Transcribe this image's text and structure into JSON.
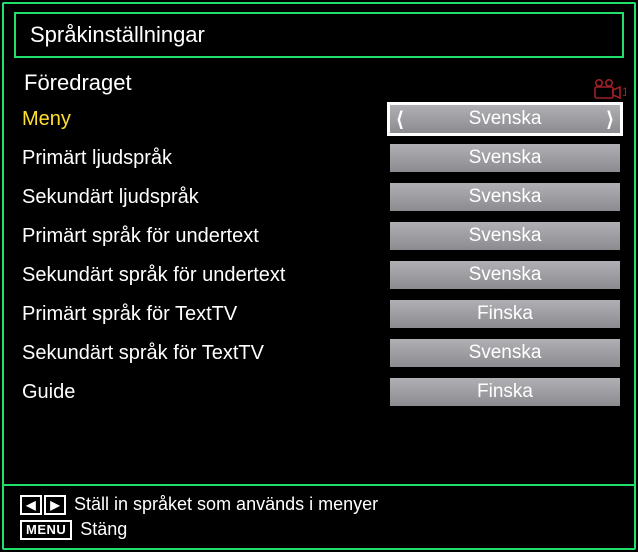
{
  "title": "Språkinställningar",
  "subtitle": "Föredraget",
  "rows": [
    {
      "label": "Meny",
      "value": "Svenska",
      "selected": true
    },
    {
      "label": "Primärt ljudspråk",
      "value": "Svenska",
      "selected": false
    },
    {
      "label": "Sekundärt ljudspråk",
      "value": "Svenska",
      "selected": false
    },
    {
      "label": "Primärt språk för undertext",
      "value": "Svenska",
      "selected": false
    },
    {
      "label": "Sekundärt språk för undertext",
      "value": "Svenska",
      "selected": false
    },
    {
      "label": "Primärt språk för TextTV",
      "value": "Finska",
      "selected": false
    },
    {
      "label": "Sekundärt språk för TextTV",
      "value": "Svenska",
      "selected": false
    },
    {
      "label": "Guide",
      "value": "Finska",
      "selected": false
    }
  ],
  "footer": {
    "arrows_hint": "Ställ in språket som används i menyer",
    "menu_key": "MENU",
    "menu_hint": "Stäng"
  },
  "camera_badge": "1"
}
